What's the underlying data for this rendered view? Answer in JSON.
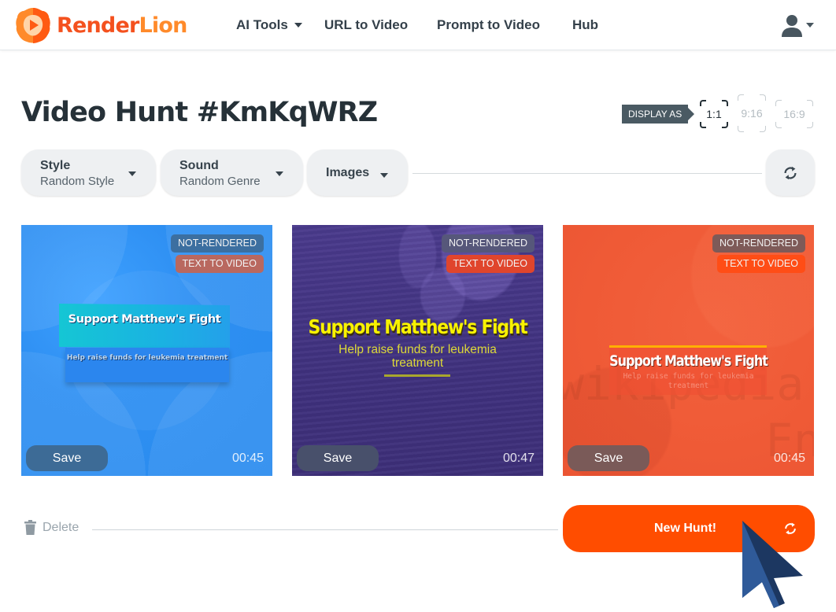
{
  "brand": {
    "name_part1": "Render",
    "name_part2": "Lion",
    "primary_color": "#f4511e",
    "secondary_color": "#ff8a2a"
  },
  "nav": {
    "items": [
      {
        "label": "AI Tools",
        "has_dropdown": true
      },
      {
        "label": "URL to Video",
        "has_dropdown": false
      },
      {
        "label": "Prompt to Video",
        "has_dropdown": false
      },
      {
        "label": "Hub",
        "has_dropdown": false
      }
    ],
    "user_icon": "user-icon"
  },
  "page": {
    "title": "Video Hunt #KmKqWRZ",
    "display_as_label": "DISPLAY AS",
    "ratios": [
      {
        "label": "1:1",
        "active": true
      },
      {
        "label": "9:16",
        "active": false
      },
      {
        "label": "16:9",
        "active": false
      }
    ]
  },
  "filters": {
    "style": {
      "label": "Style",
      "value": "Random Style"
    },
    "sound": {
      "label": "Sound",
      "value": "Random Genre"
    },
    "images": {
      "label": "Images"
    },
    "refresh_icon": "refresh-icon"
  },
  "cards": [
    {
      "status_badge": "NOT-RENDERED",
      "type_badge": "TEXT TO VIDEO",
      "title": "Support Matthew's Fight",
      "subtitle": "Help raise funds for leukemia treatment",
      "save_label": "Save",
      "duration": "00:45",
      "theme_color": "#2e8ff2"
    },
    {
      "status_badge": "NOT-RENDERED",
      "type_badge": "TEXT TO VIDEO",
      "title": "Support Matthew's Fight",
      "subtitle": "Help raise funds for leukemia treatment",
      "save_label": "Save",
      "duration": "00:47",
      "theme_color": "#3f317e"
    },
    {
      "status_badge": "NOT-RENDERED",
      "type_badge": "TEXT TO VIDEO",
      "title": "Support Matthew's Fight",
      "subtitle": "Help raise funds for leukemia treatment",
      "save_label": "Save",
      "duration": "00:45",
      "theme_color": "#ef5a36",
      "watermark_line1": "wikipedia",
      "watermark_line2": "En"
    }
  ],
  "actions": {
    "delete_label": "Delete",
    "new_hunt_label": "New Hunt!",
    "accent_color": "#ff4d00"
  }
}
